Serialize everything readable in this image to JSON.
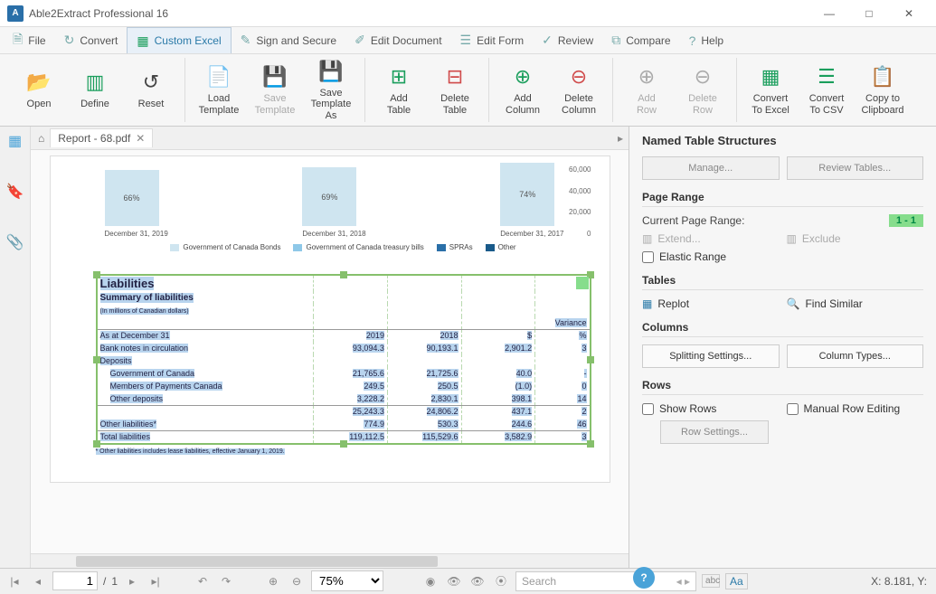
{
  "app": {
    "title": "Able2Extract Professional 16"
  },
  "menu": {
    "file": "File",
    "convert": "Convert",
    "custom_excel": "Custom Excel",
    "sign": "Sign and Secure",
    "edit_doc": "Edit Document",
    "edit_form": "Edit Form",
    "review": "Review",
    "compare": "Compare",
    "help": "Help"
  },
  "ribbon": {
    "open": "Open",
    "define": "Define",
    "reset": "Reset",
    "load_tpl": "Load\nTemplate",
    "save_tpl": "Save\nTemplate",
    "save_tpl_as": "Save\nTemplate As",
    "add_table": "Add\nTable",
    "del_table": "Delete\nTable",
    "add_col": "Add\nColumn",
    "del_col": "Delete\nColumn",
    "add_row": "Add\nRow",
    "del_row": "Delete\nRow",
    "to_excel": "Convert\nTo Excel",
    "to_csv": "Convert\nTo CSV",
    "clipboard": "Copy to\nClipboard"
  },
  "tabs": {
    "doc": "Report - 68.pdf"
  },
  "chart": {
    "bars": [
      {
        "pct": "66%",
        "h": 62,
        "date": "December 31, 2019"
      },
      {
        "pct": "69%",
        "h": 65,
        "date": "December 31, 2018"
      },
      {
        "pct": "74%",
        "h": 70,
        "date": "December 31, 2017"
      }
    ],
    "yticks": [
      "60,000",
      "40,000",
      "20,000",
      "0"
    ],
    "legend": [
      {
        "label": "Government of Canada Bonds",
        "c": "#cfe5f0"
      },
      {
        "label": "Government of Canada treasury bills",
        "c": "#8ec8e8"
      },
      {
        "label": "SPRAs",
        "c": "#2a6fa8"
      },
      {
        "label": "Other",
        "c": "#195a8a"
      }
    ]
  },
  "table": {
    "h1": "Liabilities",
    "h2": "Summary of liabilities",
    "h3": "(In millions of Canadian dollars)",
    "variance": "Variance",
    "pct": "%",
    "dollar": "$",
    "rows": [
      {
        "c1": "As at December 31",
        "c2": "2019",
        "c3": "2018",
        "c4": "$",
        "c5": "%"
      },
      {
        "c1": "Bank notes in circulation",
        "c2": "93,094.3",
        "c3": "90,193.1",
        "c4": "2,901.2",
        "c5": "3"
      },
      {
        "c1": "Deposits",
        "c2": "",
        "c3": "",
        "c4": "",
        "c5": ""
      },
      {
        "c1": "Government of Canada",
        "c2": "21,765.6",
        "c3": "21,725.6",
        "c4": "40.0",
        "c5": "-",
        "indent": true
      },
      {
        "c1": "Members of Payments Canada",
        "c2": "249.5",
        "c3": "250.5",
        "c4": "(1.0)",
        "c5": "0",
        "indent": true
      },
      {
        "c1": "Other deposits",
        "c2": "3,228.2",
        "c3": "2,830.1",
        "c4": "398.1",
        "c5": "14",
        "indent": true
      },
      {
        "c1": "",
        "c2": "25,243.3",
        "c3": "24,806.2",
        "c4": "437.1",
        "c5": "2",
        "total": true
      },
      {
        "c1": "Other liabilities*",
        "c2": "774.9",
        "c3": "530.3",
        "c4": "244.6",
        "c5": "46"
      },
      {
        "c1": "Total liabilities",
        "c2": "119,112.5",
        "c3": "115,529.6",
        "c4": "3,582.9",
        "c5": "3",
        "total": true
      }
    ],
    "footnote": "* Other liabilities includes lease liabilities, effective January 1, 2019."
  },
  "rpanel": {
    "title": "Named Table Structures",
    "manage": "Manage...",
    "review": "Review Tables...",
    "range_h": "Page Range",
    "range_lbl": "Current Page Range:",
    "range_val": "1 - 1",
    "extend": "Extend...",
    "exclude": "Exclude",
    "elastic": "Elastic Range",
    "tables_h": "Tables",
    "replot": "Replot",
    "find": "Find Similar",
    "cols_h": "Columns",
    "split": "Splitting Settings...",
    "ctypes": "Column Types...",
    "rows_h": "Rows",
    "showrows": "Show Rows",
    "manualrow": "Manual Row Editing",
    "rowset": "Row Settings..."
  },
  "status": {
    "page_cur": "1",
    "page_sep": "/",
    "page_total": "1",
    "zoom": "75%",
    "search_ph": "Search",
    "abc": "abc",
    "aa": "Aa",
    "coords": "X: 8.181, Y:"
  },
  "chart_data": {
    "type": "bar",
    "title": "",
    "categories": [
      "December 31, 2019",
      "December 31, 2018",
      "December 31, 2017"
    ],
    "series": [
      {
        "name": "Government of Canada Bonds",
        "values_pct": [
          66,
          69,
          74
        ]
      }
    ],
    "yticks": [
      0,
      20000,
      40000,
      60000
    ],
    "legend": [
      "Government of Canada Bonds",
      "Government of Canada treasury bills",
      "SPRAs",
      "Other"
    ]
  }
}
